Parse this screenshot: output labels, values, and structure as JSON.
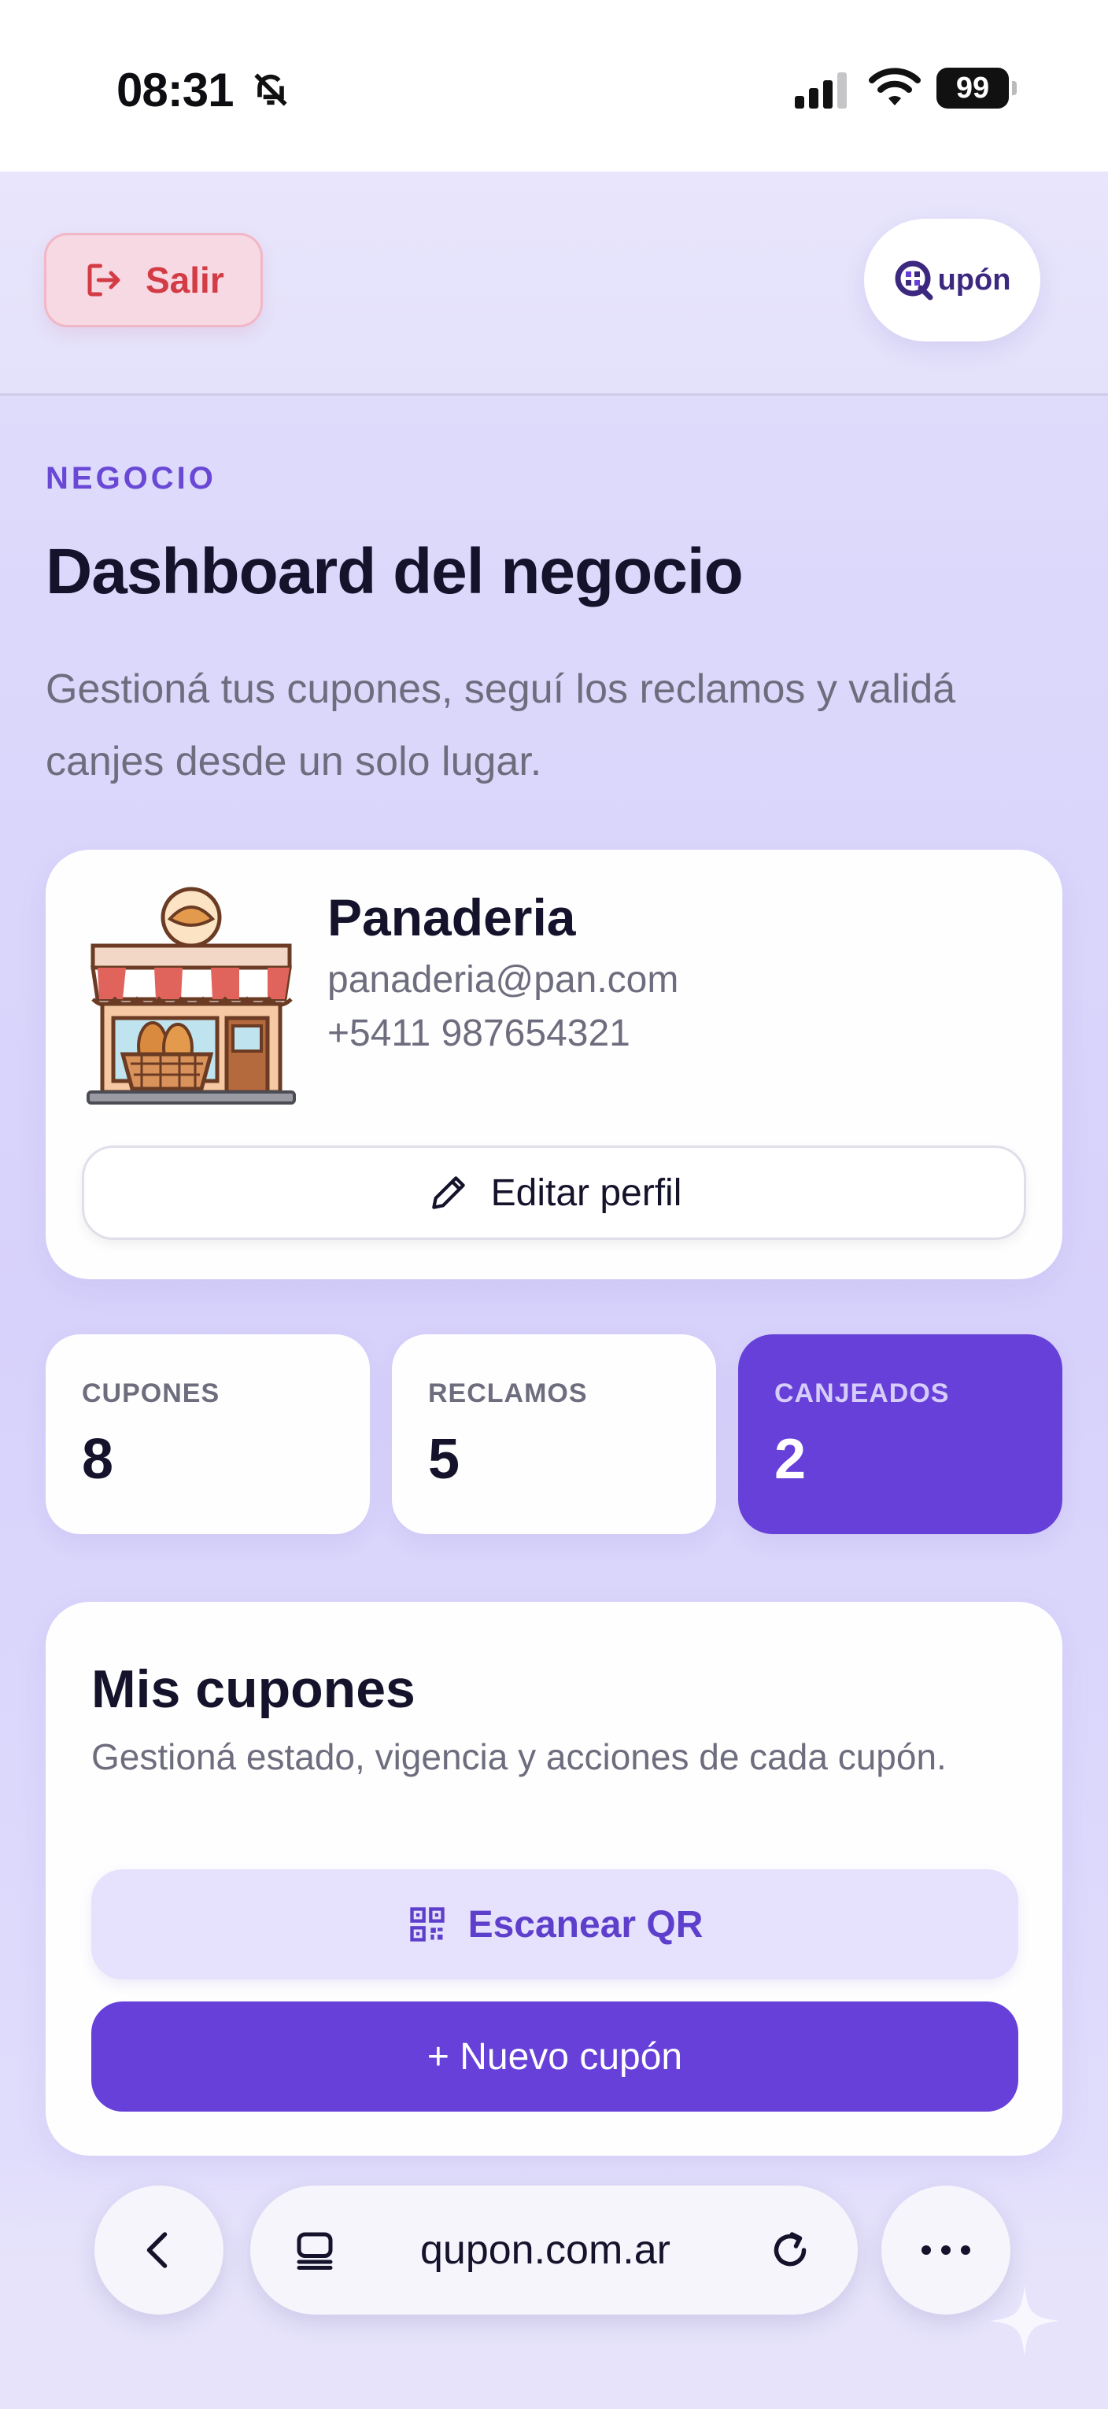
{
  "status_bar": {
    "time": "08:31",
    "battery": "99"
  },
  "header": {
    "logout_label": "Salir",
    "logo_text": "upón"
  },
  "page": {
    "eyebrow": "NEGOCIO",
    "title": "Dashboard del negocio",
    "subtitle": "Gestioná tus cupones, seguí los reclamos y validá canjes desde un solo lugar."
  },
  "profile": {
    "name": "Panaderia",
    "email": "panaderia@pan.com",
    "phone": "+5411 987654321",
    "edit_label": "Editar perfil"
  },
  "stats": [
    {
      "label": "CUPONES",
      "value": "8"
    },
    {
      "label": "RECLAMOS",
      "value": "5"
    },
    {
      "label": "CANJEADOS",
      "value": "2"
    }
  ],
  "coupons": {
    "title": "Mis cupones",
    "subtitle": "Gestioná estado, vigencia y acciones de cada cupón.",
    "scan_label": "Escanear QR",
    "new_label": "+ Nuevo cupón"
  },
  "browser": {
    "url": "qupon.com.ar"
  },
  "colors": {
    "accent": "#6640d8",
    "danger": "#d33b45",
    "text": "#15132b",
    "muted": "#6e6d7e"
  }
}
